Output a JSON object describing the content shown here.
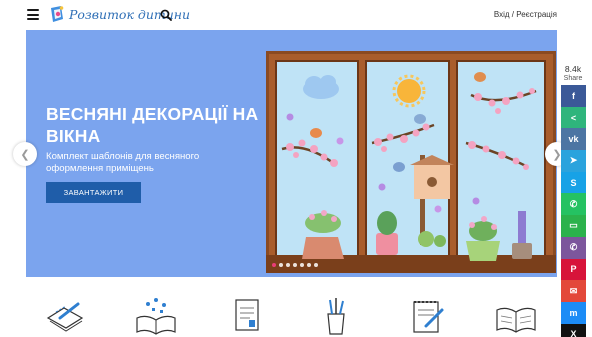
{
  "header": {
    "logo_text": "Розвиток дитини",
    "auth_text": "Вхід / Реєстрація"
  },
  "hero": {
    "title": "ВЕСНЯНІ ДЕКОРАЦІЇ НА ВІКНА",
    "subtitle": "Комплект шаблонів для весняного оформлення приміщень",
    "button_label": "ЗАВАНТАЖИТИ",
    "slide_count": 7,
    "active_slide": 1,
    "colors": {
      "background": "#7ba4ee",
      "button": "#1f5da9",
      "active_dot": "#ea3d76"
    }
  },
  "share": {
    "count": "8.4k",
    "label": "Share",
    "buttons": [
      {
        "name": "facebook",
        "color": "#3b5998",
        "glyph": "f"
      },
      {
        "name": "share",
        "color": "#2fb57c",
        "glyph": "<"
      },
      {
        "name": "vk",
        "color": "#4c75a3",
        "glyph": "vk"
      },
      {
        "name": "telegram",
        "color": "#2aa3dd",
        "glyph": "➤"
      },
      {
        "name": "skype",
        "color": "#17a2e6",
        "glyph": "S"
      },
      {
        "name": "whatsapp",
        "color": "#25c262",
        "glyph": "✆"
      },
      {
        "name": "sms",
        "color": "#2bb24c",
        "glyph": "▭"
      },
      {
        "name": "viber",
        "color": "#7c569c",
        "glyph": "✆"
      },
      {
        "name": "pinterest",
        "color": "#d7143a",
        "glyph": "P"
      },
      {
        "name": "email",
        "color": "#e3483a",
        "glyph": "✉"
      },
      {
        "name": "messenger",
        "color": "#1c8cf6",
        "glyph": "m"
      },
      {
        "name": "x",
        "color": "#111111",
        "glyph": "X"
      }
    ]
  },
  "categories": [
    {
      "icon": "pencil-notepad-icon"
    },
    {
      "icon": "open-book-doodles-icon"
    },
    {
      "icon": "document-sheet-icon"
    },
    {
      "icon": "pencil-cup-icon"
    },
    {
      "icon": "notepad-pen-icon"
    },
    {
      "icon": "open-book-icon"
    }
  ]
}
